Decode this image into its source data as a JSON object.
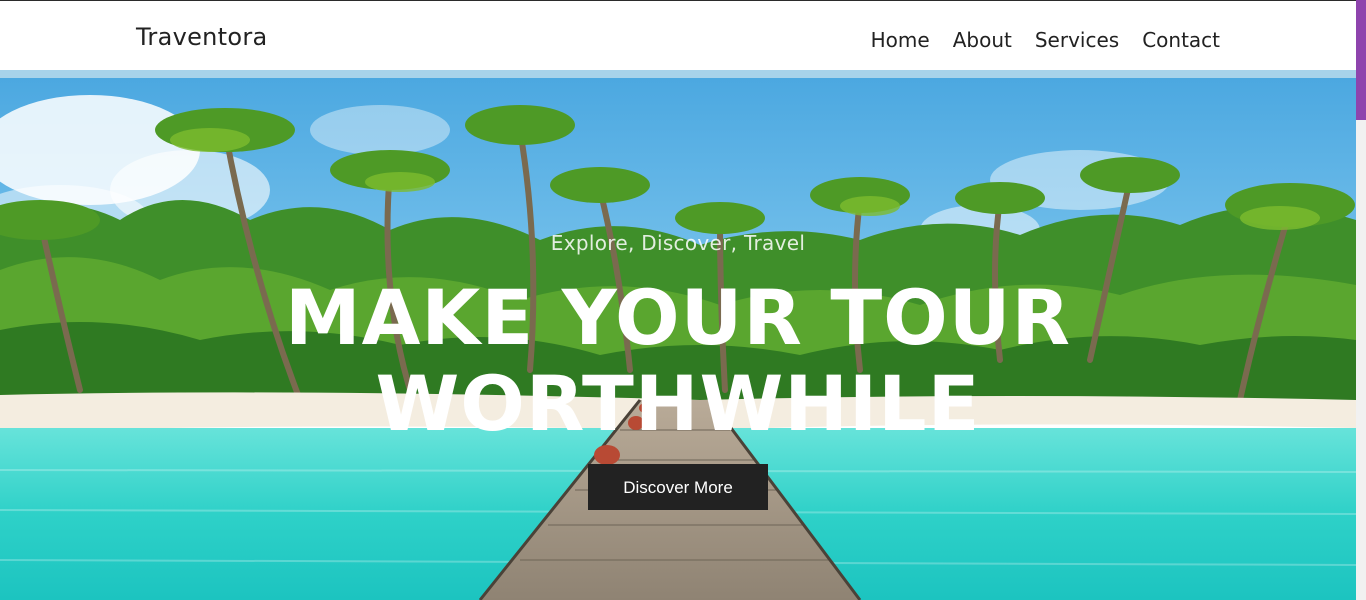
{
  "header": {
    "brand": "Traventora",
    "nav": [
      "Home",
      "About",
      "Services",
      "Contact"
    ]
  },
  "hero": {
    "tagline": "Explore, Discover, Travel",
    "headline_line1": "MAKE YOUR TOUR",
    "headline_line2": "WORTHWHILE",
    "cta_label": "Discover More"
  },
  "colors": {
    "navbar_bg": "#ffffff",
    "text_dark": "#222222",
    "cta_bg": "#222222",
    "scroll_thumb": "#8e44ad",
    "sky": "#5fb4e6",
    "sea": "#33d6cf"
  }
}
